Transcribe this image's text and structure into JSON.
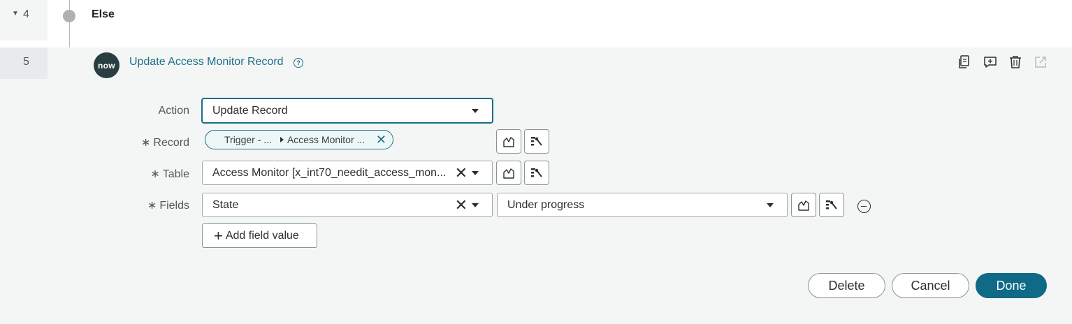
{
  "steps": {
    "else": {
      "number": "4",
      "title": "Else"
    },
    "update": {
      "number": "5",
      "logo_text": "now",
      "title": "Update Access Monitor Record",
      "help_symbol": "?"
    }
  },
  "toolbar": {
    "icons": [
      "copy-icon",
      "add-comment-icon",
      "trash-icon",
      "open-external-icon"
    ]
  },
  "form": {
    "action": {
      "label": "Action",
      "value": "Update Record"
    },
    "record": {
      "label": "Record",
      "required": "∗",
      "pill_part1": "Trigger - ...",
      "pill_part2": "Access Monitor ..."
    },
    "table": {
      "label": "Table",
      "required": "∗",
      "value": "Access Monitor [x_int70_needit_access_mon..."
    },
    "fields": {
      "label": "Fields",
      "required": "∗",
      "field_value": "State",
      "state_value": "Under progress"
    },
    "add_field_label": "Add field value"
  },
  "buttons": {
    "delete": "Delete",
    "cancel": "Cancel",
    "done": "Done"
  },
  "colors": {
    "accent": "#1a6f86",
    "primary_button": "#0e6a86",
    "logo_bg": "#293e40"
  }
}
